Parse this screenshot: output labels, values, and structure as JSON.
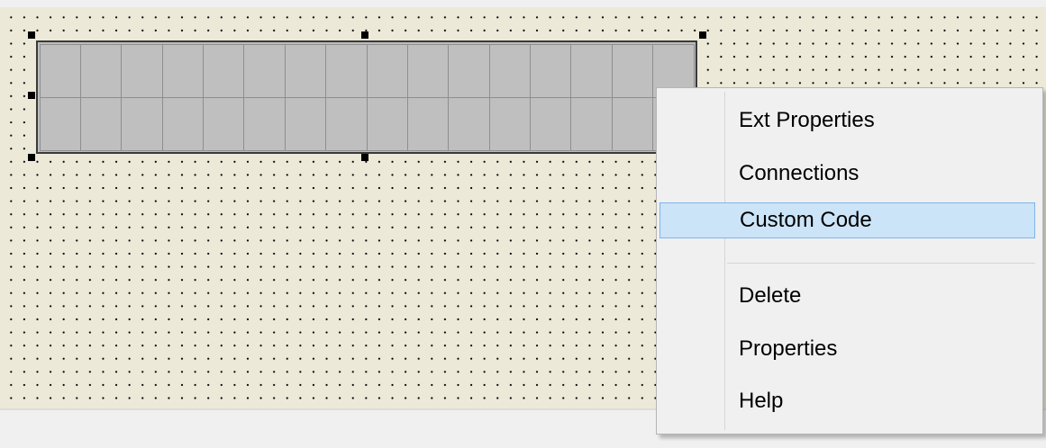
{
  "designer": {
    "lcd_rows": 2,
    "lcd_columns": 16
  },
  "context_menu": {
    "items": [
      {
        "label": "Ext Properties"
      },
      {
        "label": "Connections"
      },
      {
        "label": "Custom Code",
        "highlighted": true
      },
      {
        "label": "Delete"
      },
      {
        "label": "Properties"
      },
      {
        "label": "Help"
      }
    ],
    "highlight_color": "#cce4f7"
  }
}
